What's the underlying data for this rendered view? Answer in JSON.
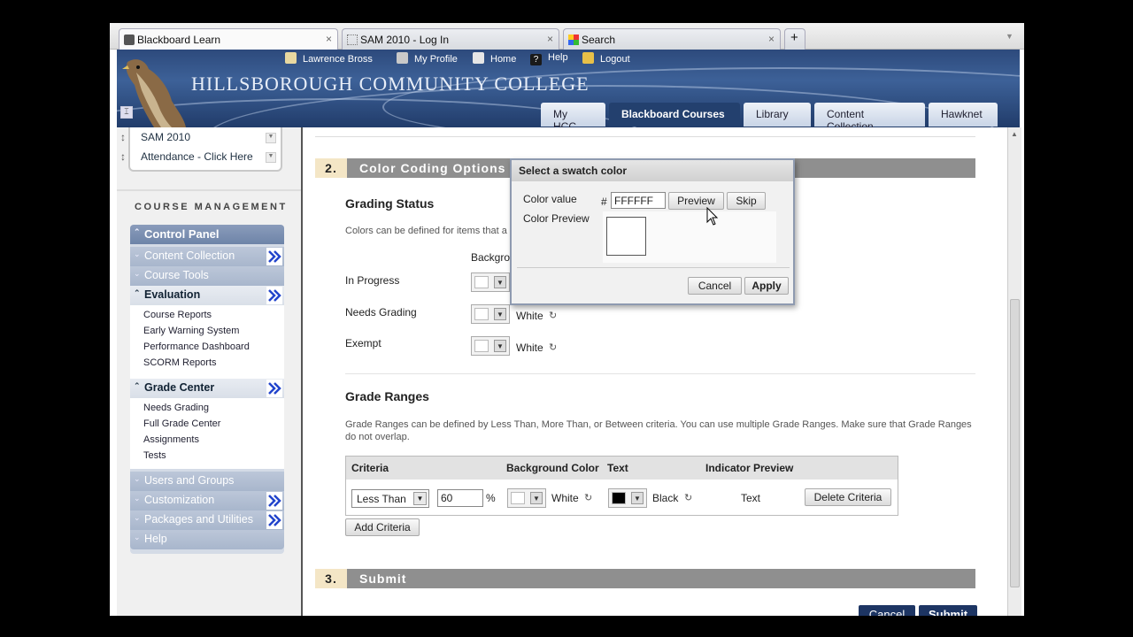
{
  "browser": {
    "tabs": [
      {
        "title": "Blackboard Learn",
        "close": "×"
      },
      {
        "title": "SAM 2010 - Log In",
        "close": "×"
      },
      {
        "title": "Search",
        "close": "×"
      }
    ],
    "new_tab": "+"
  },
  "header": {
    "college": "HILLSBOROUGH COMMUNITY COLLEGE",
    "user": "Lawrence Bross",
    "links": [
      "My Profile",
      "Home",
      "Help",
      "Logout"
    ],
    "nav_tabs": [
      "My HCC",
      "Blackboard Courses",
      "Library",
      "Content Collection",
      "Hawknet"
    ],
    "active_tab": "Blackboard Courses"
  },
  "course_menu": {
    "items": [
      "SAM 2010",
      "Attendance - Click Here"
    ]
  },
  "course_management": {
    "title": "COURSE MANAGEMENT",
    "control_panel": "Control Panel",
    "rows": [
      "Content Collection",
      "Course Tools",
      "Evaluation"
    ],
    "evaluation_items": [
      "Course Reports",
      "Early Warning System",
      "Performance Dashboard",
      "SCORM Reports"
    ],
    "grade_center": "Grade Center",
    "grade_center_items": [
      "Needs Grading",
      "Full Grade Center",
      "Assignments",
      "Tests"
    ],
    "bottom_rows": [
      "Users and Groups",
      "Customization",
      "Packages and Utilities",
      "Help"
    ]
  },
  "section2": {
    "number": "2.",
    "title": "Color Coding Options",
    "grading_status": "Grading Status",
    "desc": "Colors can be defined for items that a",
    "col_header": "Backgro",
    "rows": [
      {
        "label": "In Progress",
        "color": ""
      },
      {
        "label": "Needs Grading",
        "color": "White"
      },
      {
        "label": "Exempt",
        "color": "White"
      }
    ],
    "grade_ranges": "Grade Ranges",
    "ranges_desc_1": "Grade Ranges can be defined by Less Than, More Than, or Between criteria. You can use multiple Grade Ranges. Make sure that Grade Ranges",
    "ranges_desc_2": "do not overlap.",
    "table_headers": [
      "Criteria",
      "Background Color",
      "Text",
      "Indicator Preview"
    ],
    "criteria_value": "Less Than",
    "percent_value": "60",
    "percent_sign": "%",
    "bg_color": "White",
    "text_color": "Black",
    "preview_text": "Text",
    "delete_button": "Delete Criteria",
    "add_button": "Add Criteria"
  },
  "section3": {
    "number": "3.",
    "title": "Submit",
    "cancel": "Cancel",
    "submit": "Submit"
  },
  "dialog": {
    "title": "Select a swatch color",
    "color_value_label": "Color value",
    "hash": "#",
    "color_value": "FFFFFF",
    "preview_button": "Preview",
    "skip_button": "Skip",
    "color_preview_label": "Color Preview",
    "cancel_button": "Cancel",
    "apply_button": "Apply"
  },
  "colors": {
    "header_blue": "#2d4a7c",
    "active_tab": "#23406e",
    "section_bar": "#8f8f8f",
    "section_num": "#f4e6c6",
    "submit_button": "#1d3563"
  }
}
